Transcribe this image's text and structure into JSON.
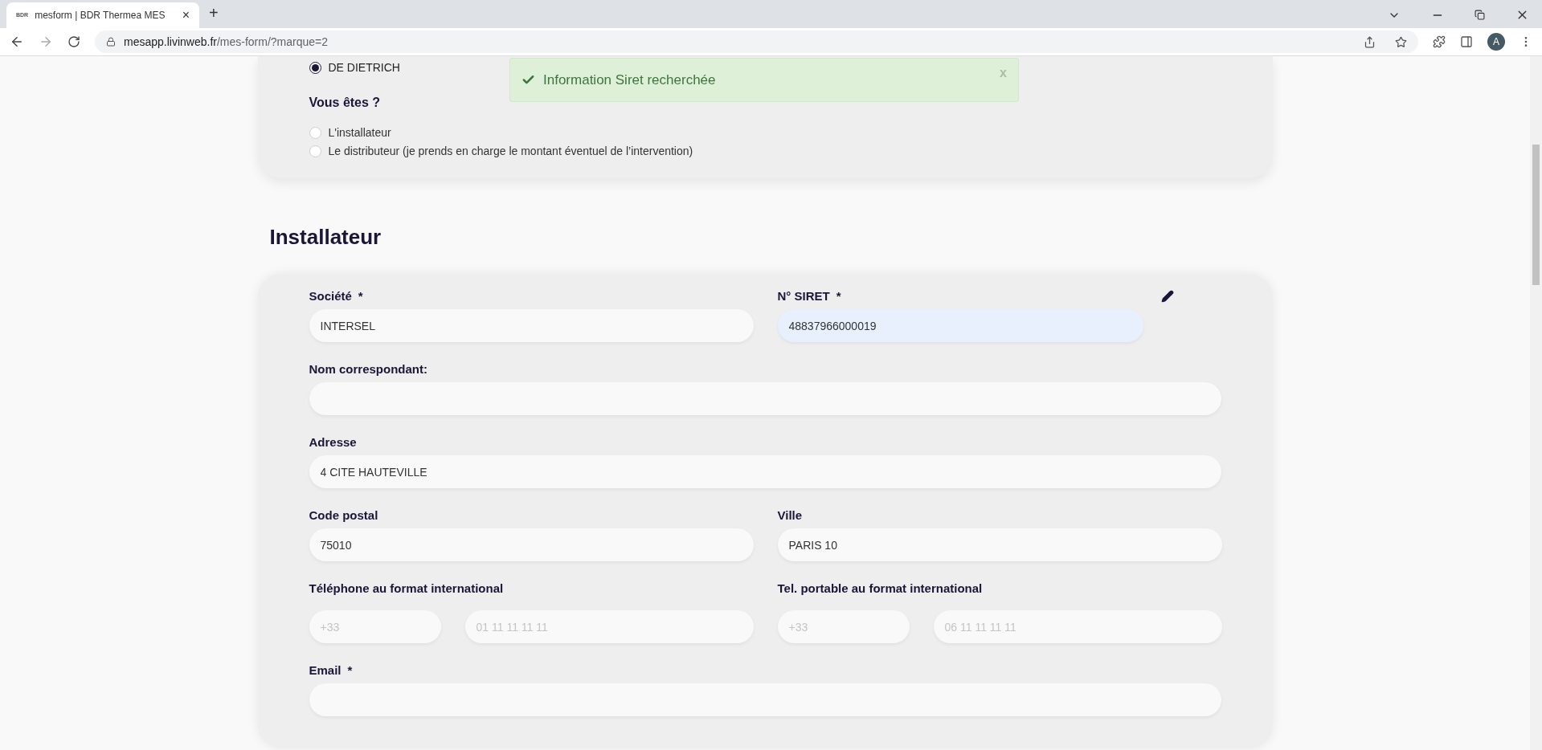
{
  "browser": {
    "tab_favicon": "BDR",
    "tab_title": "mesform | BDR Thermea MES",
    "tab_close": "×",
    "new_tab": "+",
    "url_host": "mesapp.livinweb.fr",
    "url_path": "/mes-form/?marque=2",
    "profile_initial": "A"
  },
  "toast": {
    "message": "Information Siret recherchée",
    "close": "x"
  },
  "brand_options": [
    {
      "label": "DE DIETRICH",
      "selected": true
    }
  ],
  "role_question": {
    "title": "Vous êtes ?",
    "options": [
      {
        "label": "L'installateur",
        "selected": false
      },
      {
        "label": "Le distributeur (je prends en charge le montant éventuel de l’intervention)",
        "selected": false
      }
    ]
  },
  "section_title": "Installateur",
  "form_rows": [
    [
      {
        "kind": "text",
        "label": "Société",
        "required_mark": "*",
        "value": "INTERSEL",
        "autofilled": false
      },
      {
        "kind": "text",
        "label": "N° SIRET",
        "required_mark": "*",
        "value": "48837966000019",
        "autofilled": true,
        "editable_icon": true
      }
    ],
    [
      {
        "kind": "text",
        "label": "Nom correspondant:",
        "autofilled": false
      }
    ],
    [
      {
        "kind": "text",
        "label": "Adresse",
        "value": "4 CITE HAUTEVILLE",
        "autofilled": false
      }
    ],
    [
      {
        "kind": "text",
        "label": "Code postal",
        "value": "75010",
        "autofilled": false
      },
      {
        "kind": "text",
        "label": "Ville",
        "value": "PARIS 10",
        "autofilled": false
      }
    ],
    [
      {
        "kind": "phone",
        "label": "Téléphone au format international",
        "prefix_placeholder": "+33",
        "number_placeholder": "01 11 11 11 11"
      },
      {
        "kind": "phone",
        "label": "Tel. portable au format international",
        "prefix_placeholder": "+33",
        "number_placeholder": "06 11 11 11 11"
      }
    ],
    [
      {
        "kind": "text",
        "label": "Email",
        "required_mark": "*",
        "autofilled": false
      }
    ]
  ]
}
